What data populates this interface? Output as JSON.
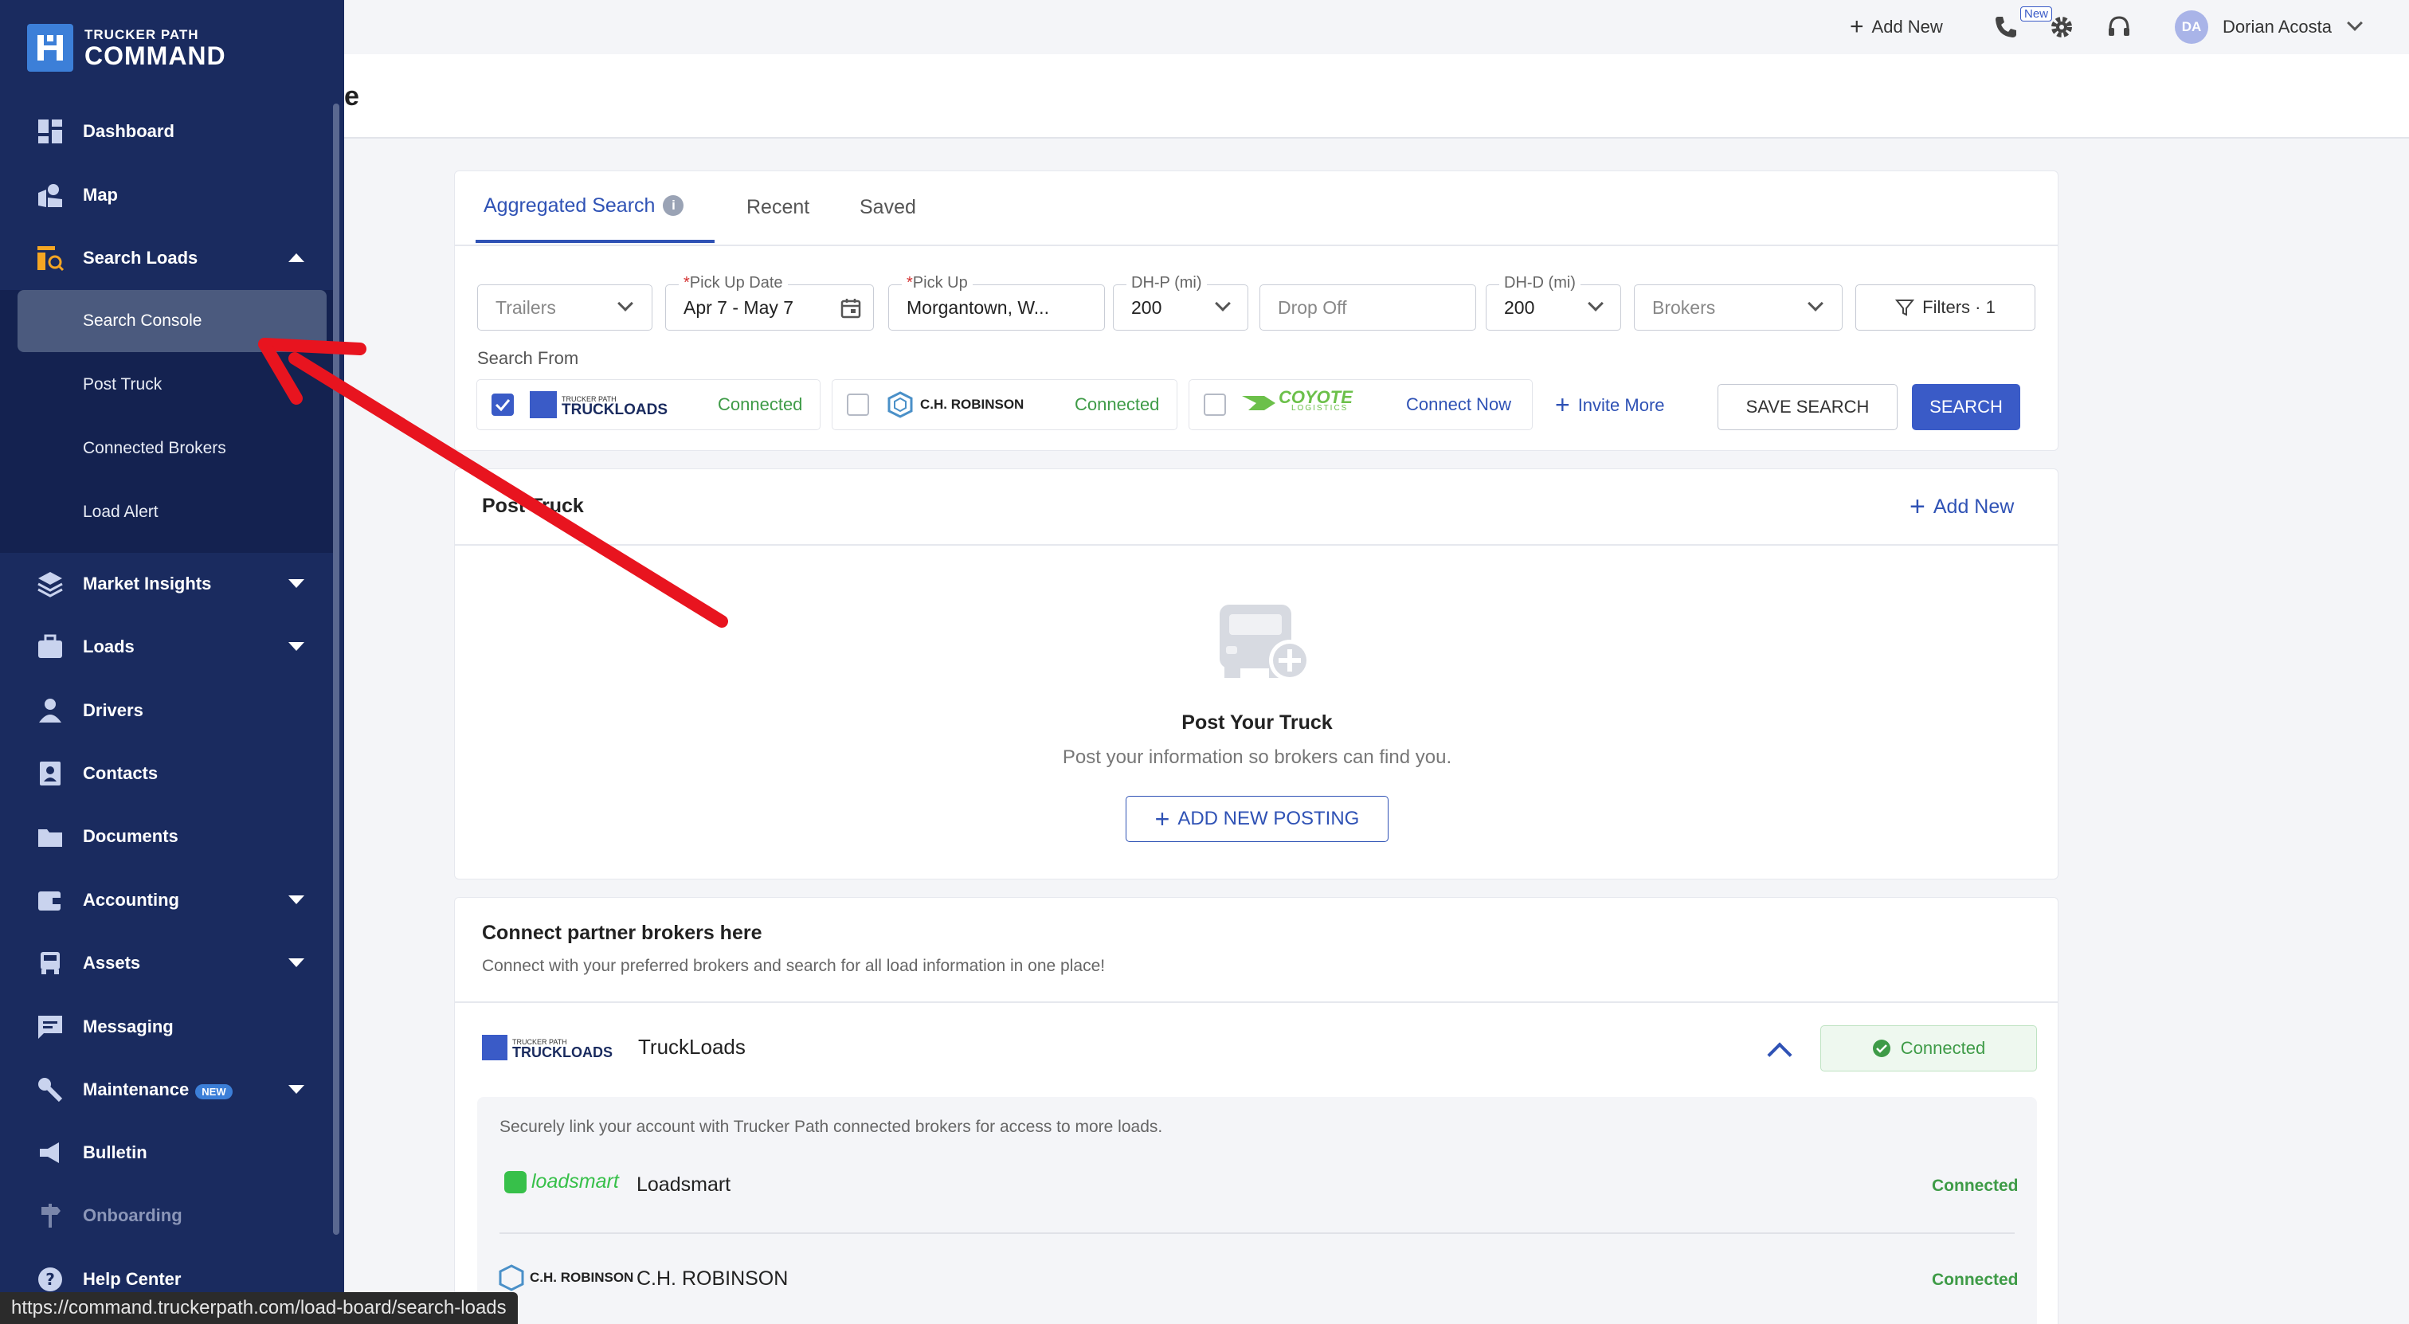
{
  "app": {
    "logo_small": "TRUCKER PATH",
    "logo_big": "COMMAND"
  },
  "sidebar": {
    "items": [
      {
        "label": "Dashboard",
        "icon": "dashboard-icon"
      },
      {
        "label": "Map",
        "icon": "map-icon"
      },
      {
        "label": "Search Loads",
        "icon": "search-loads-icon"
      },
      {
        "label": "Market Insights",
        "icon": "layers-icon"
      },
      {
        "label": "Loads",
        "icon": "briefcase-icon"
      },
      {
        "label": "Drivers",
        "icon": "driver-icon"
      },
      {
        "label": "Contacts",
        "icon": "contacts-icon"
      },
      {
        "label": "Documents",
        "icon": "folder-icon"
      },
      {
        "label": "Accounting",
        "icon": "wallet-icon"
      },
      {
        "label": "Assets",
        "icon": "truck-icon"
      },
      {
        "label": "Messaging",
        "icon": "message-icon"
      },
      {
        "label": "Maintenance",
        "icon": "wrench-icon",
        "badge": "NEW"
      },
      {
        "label": "Bulletin",
        "icon": "megaphone-icon"
      },
      {
        "label": "Onboarding",
        "icon": "signpost-icon"
      },
      {
        "label": "Help Center",
        "icon": "help-icon"
      }
    ],
    "sub_items": [
      "Search Console",
      "Post Truck",
      "Connected Brokers",
      "Load Alert"
    ]
  },
  "topbar": {
    "add_new": "Add New",
    "phone_badge": "New",
    "avatar_initials": "DA",
    "user_name": "Dorian Acosta"
  },
  "page_title_partial": "e",
  "tabs": [
    "Aggregated Search",
    "Recent",
    "Saved"
  ],
  "filters": {
    "trailers_placeholder": "Trailers",
    "pickup_date_label": "Pick Up Date",
    "pickup_date_value": "Apr 7 - May 7",
    "pickup_label": "Pick Up",
    "pickup_value": "Morgantown, W...",
    "dhp_label": "DH-P (mi)",
    "dhp_value": "200",
    "dropoff_placeholder": "Drop Off",
    "dhd_label": "DH-D (mi)",
    "dhd_value": "200",
    "brokers_placeholder": "Brokers",
    "filters_button": "Filters · 1",
    "required_mark": "*"
  },
  "search_from": {
    "label": "Search From",
    "sources": [
      {
        "logo_small": "TRUCKER PATH",
        "logo_big": "TRUCKLOADS",
        "status": "Connected",
        "checked": true
      },
      {
        "logo_big": "C.H. ROBINSON",
        "status": "Connected",
        "checked": false
      },
      {
        "logo_big": "COYOTE",
        "logo_small": "LOGISTICS",
        "status": "Connect Now",
        "checked": false
      }
    ],
    "invite_more": "Invite More",
    "save_search": "SAVE SEARCH",
    "search": "SEARCH"
  },
  "post_truck": {
    "title": "Post Truck",
    "add_new": "Add New",
    "empty_title": "Post Your Truck",
    "empty_desc": "Post your information so brokers can find you.",
    "add_posting": "ADD NEW POSTING"
  },
  "partners": {
    "title": "Connect partner brokers here",
    "desc": "Connect with your preferred brokers and search for all load information in one place!",
    "truckloads_name": "TruckLoads",
    "truckloads_status": "Connected",
    "link_desc": "Securely link your account with Trucker Path connected brokers for access to more loads.",
    "brokers": [
      {
        "logo": "loadsmart",
        "name": "Loadsmart",
        "status": "Connected"
      },
      {
        "logo": "C.H. ROBINSON",
        "name": "C.H. ROBINSON",
        "status": "Connected"
      }
    ]
  },
  "status_url": "https://command.truckerpath.com/load-board/search-loads",
  "colors": {
    "sidebar": "#1a2b5f",
    "primary": "#3a5bc7",
    "success": "#3e9b47",
    "annotation_arrow": "#e8141f"
  }
}
